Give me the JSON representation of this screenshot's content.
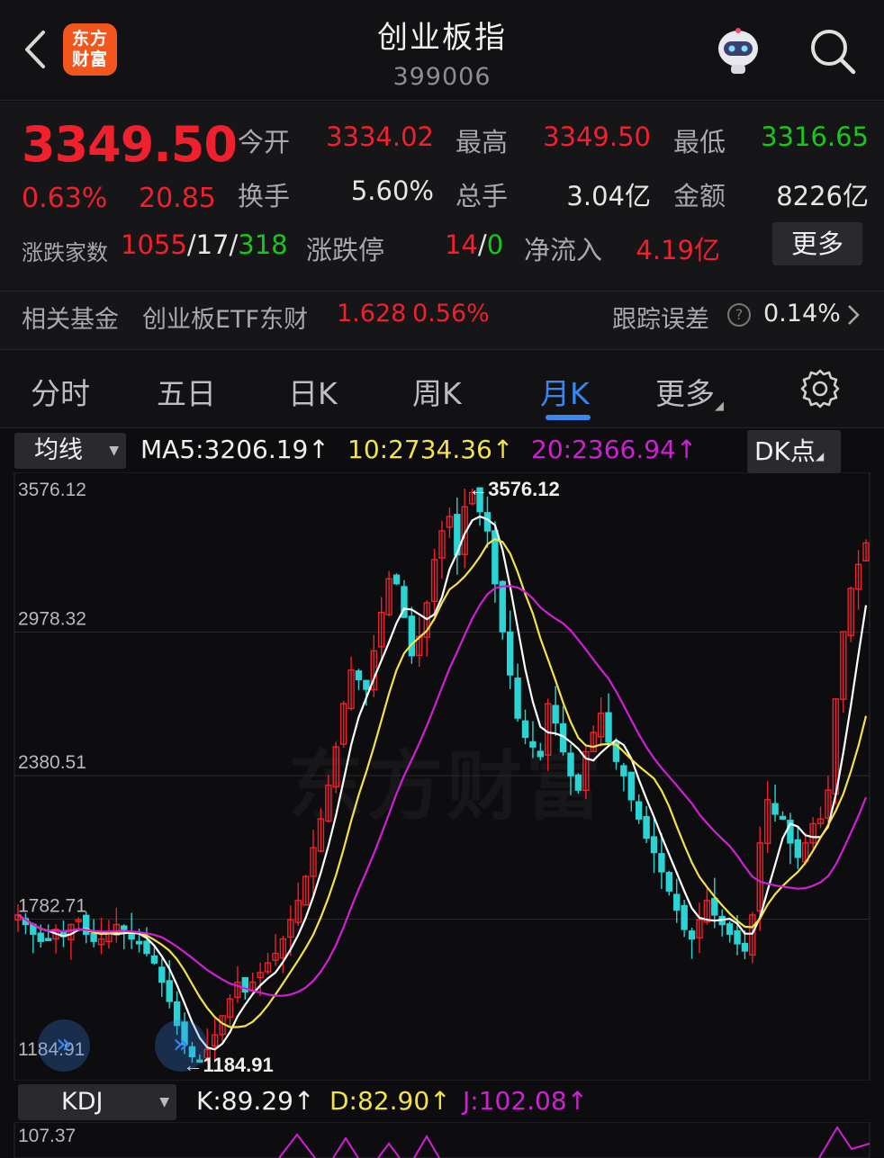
{
  "header": {
    "title": "创业板指",
    "code": "399006",
    "logo_text": "东方财富"
  },
  "quote": {
    "price": "3349.50",
    "change_pct": "0.63%",
    "change": "20.85",
    "open_label": "今开",
    "open": "3334.02",
    "high_label": "最高",
    "high": "3349.50",
    "low_label": "最低",
    "low": "3316.65",
    "turnover_label": "换手",
    "turnover": "5.60%",
    "volume_label": "总手",
    "volume": "3.04亿",
    "amount_label": "金额",
    "amount": "8226亿",
    "breadth_label": "涨跌家数",
    "up_count": "1055",
    "flat_count": "17",
    "down_count": "318",
    "limit_label": "涨跌停",
    "limit_up": "14",
    "limit_down": "0",
    "netflow_label": "净流入",
    "netflow": "4.19亿",
    "more_label": "更多",
    "fund_label": "相关基金",
    "fund_name": "创业板ETF东财",
    "fund_price": "1.628",
    "fund_pct": "0.56%",
    "tracking_label": "跟踪误差",
    "tracking_value": "0.14%"
  },
  "tabs": [
    {
      "label": "分时"
    },
    {
      "label": "五日"
    },
    {
      "label": "日K"
    },
    {
      "label": "周K"
    },
    {
      "label": "月K",
      "active": true
    },
    {
      "label": "更多"
    }
  ],
  "indicators": {
    "ma_selector": "均线",
    "ma5": "MA5:3206.19↑",
    "ma10": "10:2734.36↑",
    "ma20": "20:2366.94↑",
    "dk_button": "DK点",
    "kdj_selector": "KDJ",
    "k": "K:89.29↑",
    "d": "D:82.90↑",
    "j": "J:102.08↑"
  },
  "chart_data": {
    "type": "candlestick",
    "y_axis_labels": [
      "3576.12",
      "2978.32",
      "2380.51",
      "1782.71",
      "1184.91"
    ],
    "ylim": [
      1184.91,
      3576.12
    ],
    "max_annotation": "3576.12",
    "min_annotation": "1184.91",
    "kdj_axis_label": "107.37",
    "colors": {
      "up": "#f0202c",
      "down": "#2ad4d4",
      "ma5": "#ffffff",
      "ma10": "#f3e24a",
      "ma20": "#d21fd6"
    },
    "monthly_closes": [
      1800,
      1760,
      1720,
      1690,
      1700,
      1740,
      1710,
      1760,
      1780,
      1720,
      1690,
      1700,
      1730,
      1760,
      1740,
      1700,
      1680,
      1640,
      1600,
      1520,
      1440,
      1340,
      1260,
      1210,
      1190,
      1240,
      1300,
      1380,
      1450,
      1520,
      1480,
      1520,
      1560,
      1600,
      1640,
      1700,
      1780,
      1860,
      1960,
      2080,
      2200,
      2340,
      2500,
      2680,
      2820,
      2780,
      2740,
      2900,
      3060,
      3200,
      3180,
      3040,
      2880,
      2960,
      3100,
      3280,
      3400,
      3460,
      3300,
      3500,
      3560,
      3480,
      3400,
      3180,
      2980,
      2800,
      2620,
      2540,
      2500,
      2460,
      2680,
      2600,
      2480,
      2380,
      2320,
      2480,
      2560,
      2640,
      2520,
      2440,
      2380,
      2280,
      2200,
      2120,
      2060,
      1980,
      1900,
      1820,
      1740,
      1700,
      1780,
      1860,
      1800,
      1760,
      1720,
      1680,
      1650,
      1800,
      2100,
      2280,
      2220,
      2200,
      2100,
      2040,
      2100,
      2180,
      2200,
      2320,
      2700,
      2980,
      3160,
      3260,
      3349.5
    ]
  }
}
